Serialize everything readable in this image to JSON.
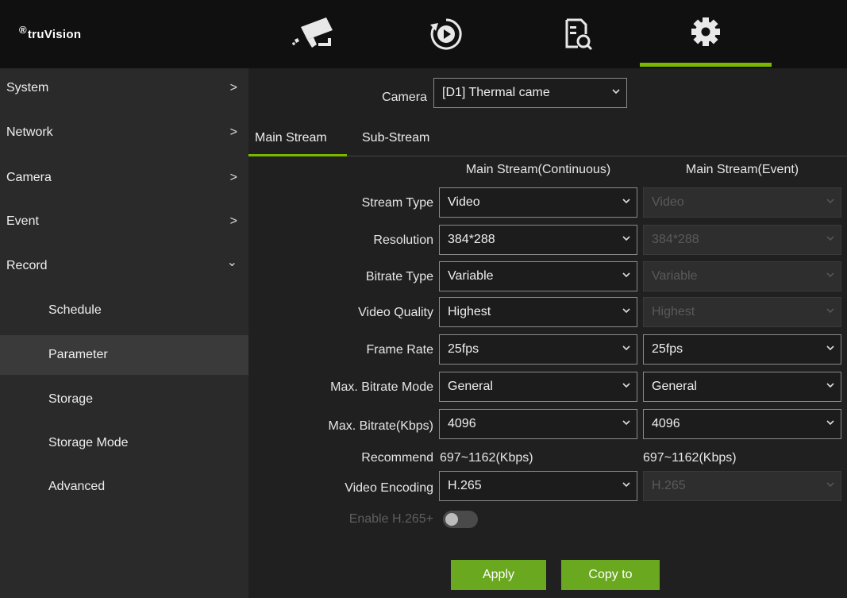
{
  "brand": {
    "name": "truVision"
  },
  "top_nav": [
    {
      "icon": "camera-icon"
    },
    {
      "icon": "playback-icon"
    },
    {
      "icon": "search-file-icon"
    },
    {
      "icon": "gear-icon",
      "active": true
    }
  ],
  "sidebar": {
    "items": [
      {
        "label": "System",
        "chevron": ">"
      },
      {
        "label": "Network",
        "chevron": ">"
      },
      {
        "label": "Camera",
        "chevron": ">"
      },
      {
        "label": "Event",
        "chevron": ">"
      },
      {
        "label": "Record",
        "chevron": "⌄"
      },
      {
        "label": "Schedule"
      },
      {
        "label": "Parameter",
        "selected": true
      },
      {
        "label": "Storage"
      },
      {
        "label": "Storage Mode"
      },
      {
        "label": "Advanced"
      }
    ]
  },
  "camera": {
    "label": "Camera",
    "value": "[D1] Thermal came"
  },
  "tabs": [
    {
      "label": "Main Stream",
      "active": true
    },
    {
      "label": "Sub-Stream"
    }
  ],
  "columns": {
    "continuous": "Main Stream(Continuous)",
    "event": "Main Stream(Event)"
  },
  "rows": [
    {
      "label": "Stream Type",
      "cont": "Video",
      "event": "Video",
      "event_disabled": true
    },
    {
      "label": "Resolution",
      "cont": "384*288",
      "event": "384*288",
      "event_disabled": true
    },
    {
      "label": "Bitrate Type",
      "cont": "Variable",
      "event": "Variable",
      "event_disabled": true
    },
    {
      "label": "Video Quality",
      "cont": "Highest",
      "event": "Highest",
      "event_disabled": true
    },
    {
      "label": "Frame Rate",
      "cont": "25fps",
      "event": "25fps",
      "event_disabled": false
    },
    {
      "label": "Max. Bitrate Mode",
      "cont": "General",
      "event": "General",
      "event_disabled": false
    },
    {
      "label": "Max. Bitrate(Kbps)",
      "cont": "4096",
      "event": "4096",
      "event_disabled": false
    }
  ],
  "recommend": {
    "label": "Recommend",
    "cont": "697~1162(Kbps)",
    "event": "697~1162(Kbps)"
  },
  "encoding": {
    "label": "Video Encoding",
    "cont": "H.265",
    "event": "H.265"
  },
  "h265plus": {
    "label": "Enable H.265+",
    "enabled": false
  },
  "buttons": {
    "apply": "Apply",
    "copy": "Copy to"
  },
  "colors": {
    "accent": "#7ab800",
    "button": "#6aa820"
  }
}
